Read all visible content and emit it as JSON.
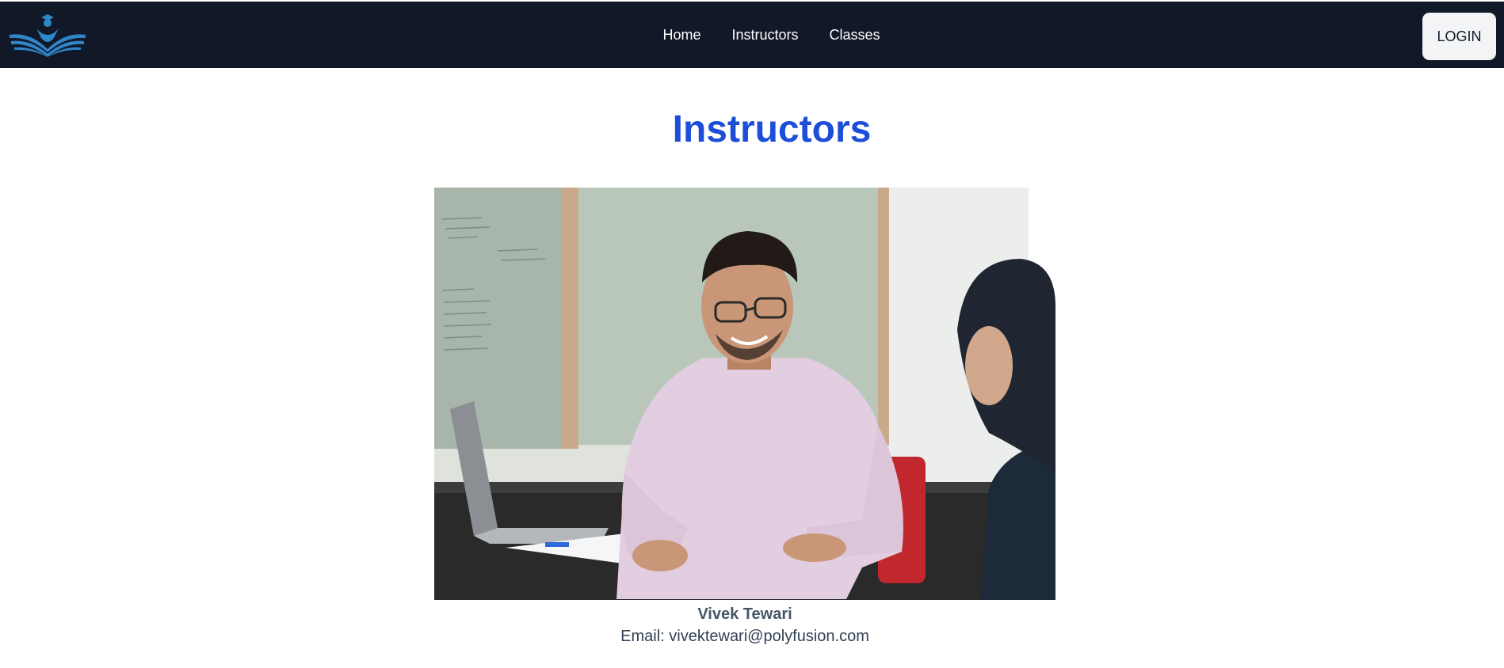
{
  "header": {
    "nav": [
      {
        "label": "Home"
      },
      {
        "label": "Instructors"
      },
      {
        "label": "Classes"
      }
    ],
    "login_label": "LOGIN"
  },
  "main": {
    "title": "Instructors",
    "instructors": [
      {
        "name": "Vivek Tewari",
        "email": "Email: vivektewari@polyfusion.com"
      }
    ]
  },
  "colors": {
    "nav_bg": "#111827",
    "title": "#1d4ed8",
    "logo": "#2f86c9"
  },
  "icons": {
    "logo": "open-book-graduate-icon"
  }
}
